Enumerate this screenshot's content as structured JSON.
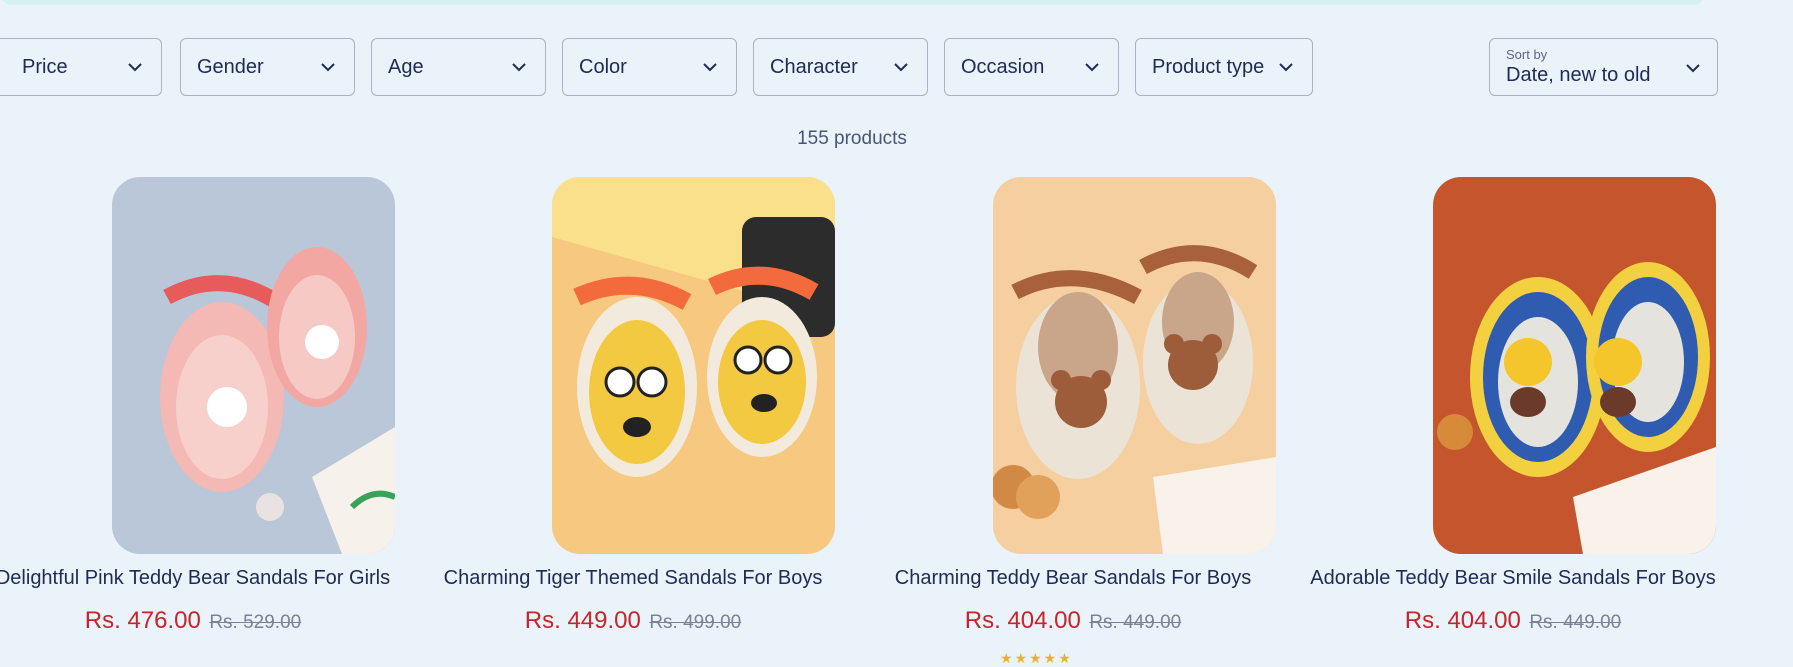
{
  "filters": [
    {
      "label": "Price"
    },
    {
      "label": "Gender"
    },
    {
      "label": "Age"
    },
    {
      "label": "Color"
    },
    {
      "label": "Character"
    },
    {
      "label": "Occasion"
    },
    {
      "label": "Product type"
    }
  ],
  "sort": {
    "label": "Sort by",
    "value": "Date, new to old"
  },
  "product_count": "155 products",
  "products": [
    {
      "title": "Delightful Pink Teddy Bear Sandals For Girls",
      "price": "Rs. 476.00",
      "compare_price": "Rs. 529.00"
    },
    {
      "title": "Charming Tiger Themed Sandals For Boys",
      "price": "Rs. 449.00",
      "compare_price": "Rs. 499.00"
    },
    {
      "title": "Charming Teddy Bear Sandals For Boys",
      "price": "Rs. 404.00",
      "compare_price": "Rs. 449.00"
    },
    {
      "title": "Adorable Teddy Bear Smile Sandals For Boys",
      "price": "Rs. 404.00",
      "compare_price": "Rs. 449.00"
    }
  ],
  "colors": {
    "accent": "#c8232a",
    "text": "#1f2a55",
    "background": "#eaf3f9"
  },
  "icons": {
    "dropdown": "chevron-down-icon"
  }
}
